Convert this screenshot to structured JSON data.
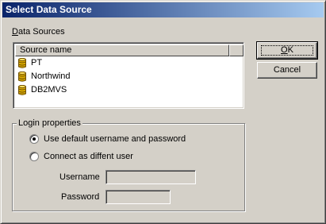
{
  "window": {
    "title": "Select Data Source"
  },
  "datasources": {
    "label_prefix": "D",
    "label_rest": "ata Sources",
    "column_header": "Source name",
    "items": [
      {
        "name": "PT",
        "icon": "database-icon"
      },
      {
        "name": "Northwind",
        "icon": "database-icon"
      },
      {
        "name": "DB2MVS",
        "icon": "database-icon"
      }
    ]
  },
  "buttons": {
    "ok_prefix": "O",
    "ok_rest": "K",
    "cancel": "Cancel"
  },
  "login": {
    "legend": "Login properties",
    "option_default": "Use default username and password",
    "option_different": "Connect as diffent user",
    "selected": "default",
    "username_label": "Username",
    "password_label": "Password",
    "username_value": "",
    "password_value": ""
  },
  "colors": {
    "title_start": "#0a246a",
    "title_end": "#a6caf0",
    "face": "#d4d0c8"
  }
}
